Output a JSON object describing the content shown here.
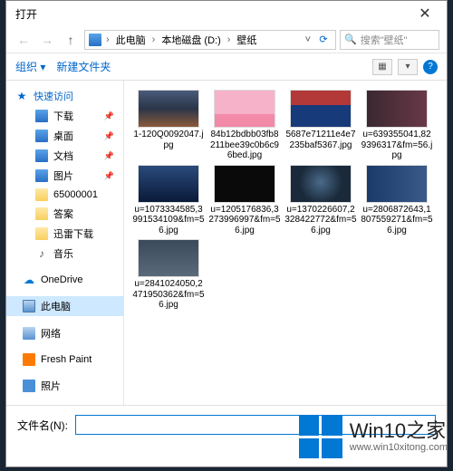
{
  "titlebar": {
    "title": "打开"
  },
  "address": {
    "segments": [
      "此电脑",
      "本地磁盘 (D:)",
      "壁纸"
    ],
    "separator": "›"
  },
  "search": {
    "placeholder": "搜索\"壁纸\""
  },
  "toolbar": {
    "organize": "组织 ▾",
    "new_folder": "新建文件夹"
  },
  "sidebar": {
    "quick_access": "快速访问",
    "downloads": "下载",
    "desktop": "桌面",
    "documents": "文档",
    "pictures": "图片",
    "num_folder": "65000001",
    "answers": "答案",
    "thunder": "迅雷下载",
    "music": "音乐",
    "onedrive": "OneDrive",
    "this_pc": "此电脑",
    "network": "网络",
    "fresh_paint": "Fresh Paint",
    "photos": "照片"
  },
  "files": [
    {
      "name": "1-120Q0092047.jpg",
      "thumb": "t1"
    },
    {
      "name": "84b12bdbb03fb8211bee39c0b6c96bed.jpg",
      "thumb": "t2"
    },
    {
      "name": "5687e71211e4e7235baf5367.jpg",
      "thumb": "t3"
    },
    {
      "name": "u=639355041,829396317&fm=56.jpg",
      "thumb": "t4"
    },
    {
      "name": "u=1073334585,3991534109&fm=56.jpg",
      "thumb": "t5"
    },
    {
      "name": "u=1205176836,3273996997&fm=56.jpg",
      "thumb": "t6"
    },
    {
      "name": "u=1370226607,2328422772&fm=56.jpg",
      "thumb": "t7"
    },
    {
      "name": "u=2806872643,1807559271&fm=56.jpg",
      "thumb": "t8"
    },
    {
      "name": "u=2841024050,2471950362&fm=56.jpg",
      "thumb": "t9"
    }
  ],
  "bottom": {
    "filename_label": "文件名(N):",
    "filename_value": ""
  },
  "watermark": {
    "brand": "Win10",
    "suffix": "之家",
    "url": "www.win10xitong.com"
  }
}
